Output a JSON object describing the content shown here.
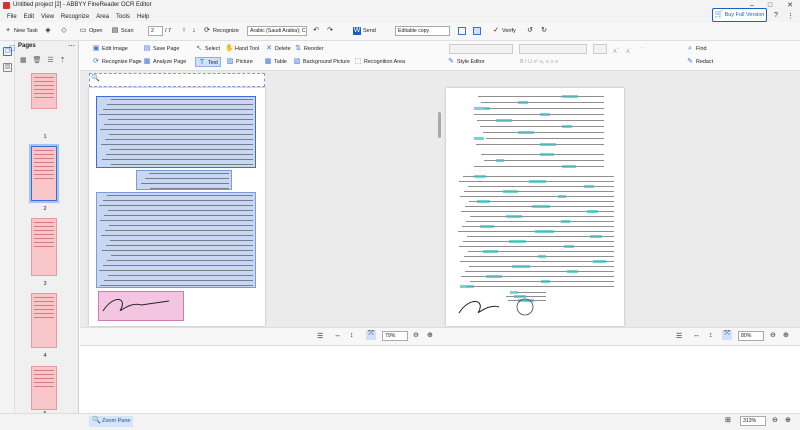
{
  "window": {
    "title": "Untitled project [2] - ABBYY FineReader OCR Editor"
  },
  "menu": [
    "File",
    "Edit",
    "View",
    "Recognize",
    "Area",
    "Tools",
    "Help"
  ],
  "toolbar": {
    "new_task": "New Task",
    "open": "Open",
    "scan": "Scan",
    "page_current": "2",
    "page_total": "/ 7",
    "recognize": "Recognize",
    "language": "Arabic (Saudi Arabia); C",
    "send": "Send",
    "format": "Editable copy",
    "verify": "Verify",
    "buy_full": "Buy Full Version"
  },
  "sidebar": {
    "title": "Pages",
    "page_numbers": [
      "1",
      "2",
      "3",
      "4",
      "5"
    ]
  },
  "ribbon": {
    "edit_image": "Edit Image",
    "save_page": "Save Page",
    "recognize_page": "Recognize Page",
    "analyze_page": "Analyze Page",
    "select": "Select",
    "hand_tool": "Hand Tool",
    "delete": "Delete",
    "reorder": "Reorder",
    "text": "Text",
    "picture": "Picture",
    "table": "Table",
    "background_picture": "Background Picture",
    "recognition_area": "Recognition Area",
    "style_editor": "Style Editor",
    "find": "Find",
    "redact": "Redact"
  },
  "bottom": {
    "zoom_left": "79%",
    "zoom_right": "80%"
  },
  "status": {
    "zoom_pane": "Zoom Pane",
    "zoom_level": "313%"
  }
}
